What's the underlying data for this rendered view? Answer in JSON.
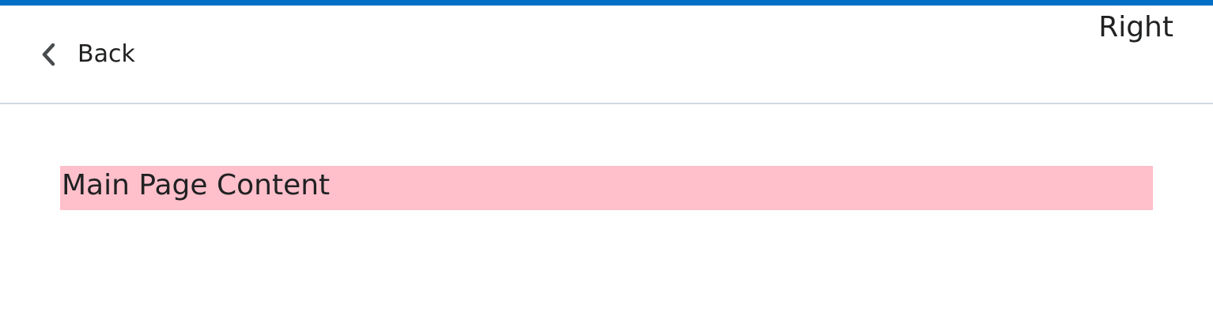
{
  "theme": {
    "accent_color": "#0070c6",
    "content_highlight_color": "#ffc0cb"
  },
  "header": {
    "back_icon": "chevron-left-icon",
    "back_label": "Back",
    "right_label": "Right"
  },
  "main": {
    "content_text": "Main Page Content"
  }
}
